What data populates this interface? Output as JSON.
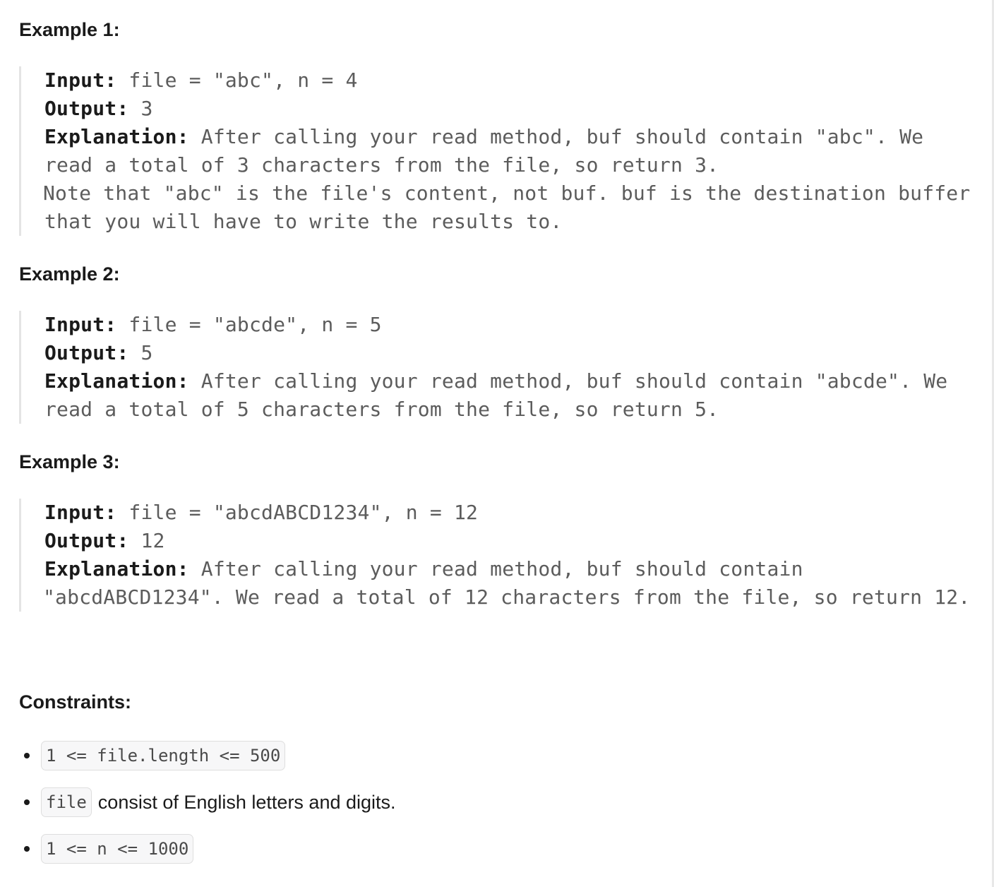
{
  "examples": [
    {
      "title": "Example 1:",
      "input_key": "Input:",
      "input_value": " file = \"abc\", n = 4",
      "output_key": "Output:",
      "output_value": " 3",
      "explanation_key": "Explanation:",
      "explanation_lines": [
        " After calling your read method, buf should contain \"abc\". We",
        "read a total of 3 characters from the file, so return 3.",
        "Note that \"abc\" is the file's content, not buf. buf is the destination buffer",
        "that you will have to write the results to."
      ]
    },
    {
      "title": "Example 2:",
      "input_key": "Input:",
      "input_value": " file = \"abcde\", n = 5",
      "output_key": "Output:",
      "output_value": " 5",
      "explanation_key": "Explanation:",
      "explanation_lines": [
        " After calling your read method, buf should contain \"abcde\". We",
        "read a total of 5 characters from the file, so return 5."
      ]
    },
    {
      "title": "Example 3:",
      "input_key": "Input:",
      "input_value": " file = \"abcdABCD1234\", n = 12",
      "output_key": "Output:",
      "output_value": " 12",
      "explanation_key": "Explanation:",
      "explanation_lines": [
        " After calling your read method, buf should contain",
        "\"abcdABCD1234\". We read a total of 12 characters from the file, so return 12."
      ]
    }
  ],
  "constraints": {
    "title": "Constraints:",
    "items": [
      {
        "code": "1 <= file.length <= 500",
        "text": ""
      },
      {
        "code": "file",
        "text": "consist of English letters and digits."
      },
      {
        "code": "1 <= n <= 1000",
        "text": ""
      }
    ]
  }
}
